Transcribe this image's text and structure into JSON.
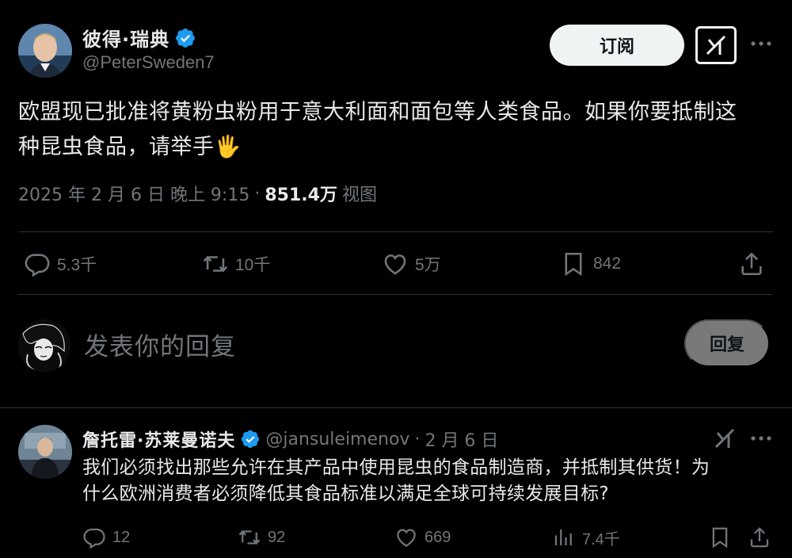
{
  "tweet": {
    "author_name": "彼得·瑞典",
    "author_handle": "@PeterSweden7",
    "subscribe_label": "订阅",
    "text_line1": "欧盟现已批准将黄粉虫粉用于意大利面和面包等人类食品。如果你要抵制这",
    "text_line2": "种昆虫食品，请举手",
    "emoji": "🖐",
    "timestamp": "2025 年 2 月 6 日 晚上 9:15",
    "separator": "·",
    "views_count": "851.4万",
    "views_label": "视图",
    "actions": {
      "replies": "5.3千",
      "reposts": "10千",
      "likes": "5万",
      "bookmarks": "842"
    }
  },
  "composer": {
    "placeholder": "发表你的回复",
    "reply_button": "回复"
  },
  "reply": {
    "author_name": "詹托雷·苏莱曼诺夫",
    "author_handle": "@jansuleimenov",
    "separator": "·",
    "date": "2 月 6 日",
    "text_line1": "我们必须找出那些允许在其产品中使用昆虫的食品制造商，并抵制其供货！为",
    "text_line2": "什么欧洲消费者必须降低其食品标准以满足全球可持续发展目标?",
    "actions": {
      "replies": "12",
      "reposts": "92",
      "likes": "669",
      "views": "7.4千"
    }
  },
  "colors": {
    "background": "#000000",
    "text": "#e7e9ea",
    "muted": "#71767b",
    "verified": "#1d9bf0",
    "divider": "#2f3336"
  }
}
